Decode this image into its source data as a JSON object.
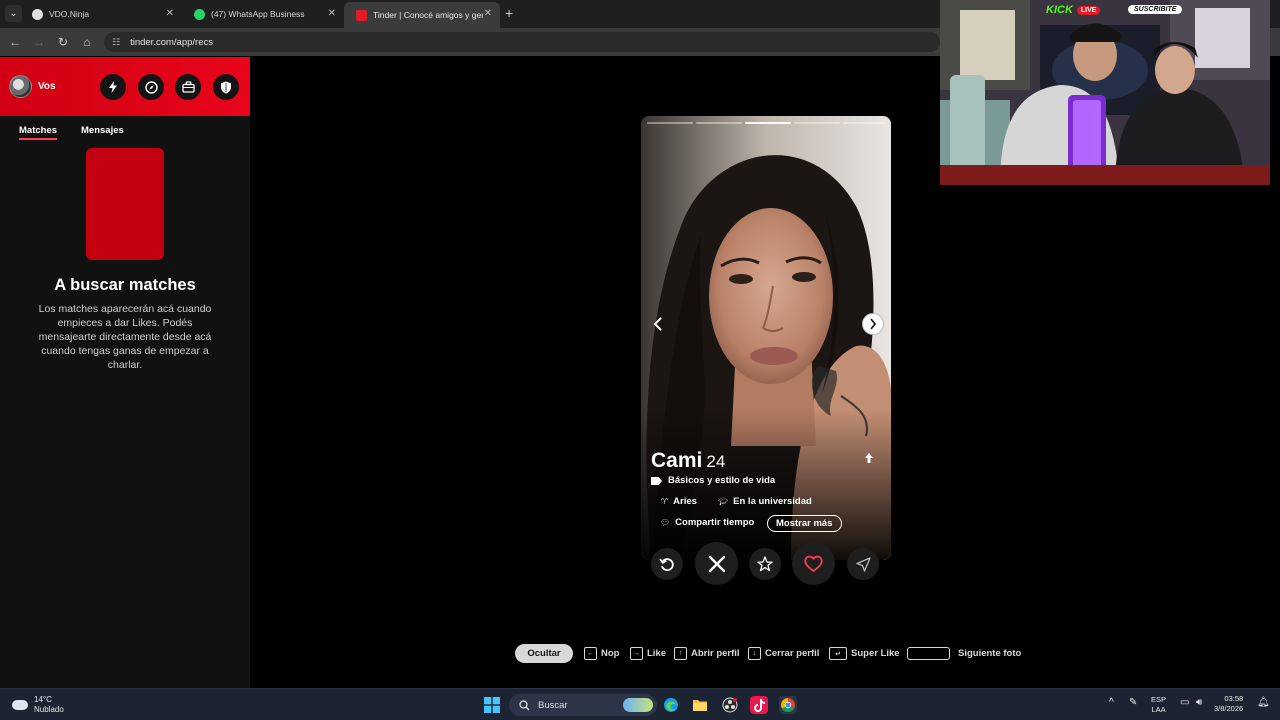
{
  "browser": {
    "tabs": [
      {
        "title": "VDO.Ninja",
        "active": false,
        "favicon_color": "#4d4d4d"
      },
      {
        "title": "(47) WhatsApp Business",
        "active": false,
        "favicon_color": "#25d366"
      },
      {
        "title": "Tinder | Conocé amigos y gente",
        "active": true,
        "favicon_color": "#fe3c55"
      }
    ],
    "new_tab_label": "+",
    "address": "tinder.com/app/recs"
  },
  "sidebar": {
    "user_name": "Vos",
    "tabs": [
      {
        "label": "Matches",
        "active": true
      },
      {
        "label": "Mensajes",
        "active": false
      }
    ],
    "empty_title": "A buscar matches",
    "empty_text": "Los matches aparecerán acá cuando empieces a dar Likes. Podés mensajearte directamente desde acá cuando tengas ganas de empezar a charlar."
  },
  "profile": {
    "name": "Cami",
    "age": "24",
    "photo_count": 5,
    "current_photo": 3,
    "tagline": "Básicos y estilo de vida",
    "chips": [
      "Aries",
      "En la universidad"
    ],
    "extra": "Compartir tiempo",
    "more_label": "Mostrar más"
  },
  "actions": [
    "rewind",
    "nope",
    "super-like",
    "like",
    "boost"
  ],
  "hints": {
    "hide_label": "Ocultar",
    "items": [
      "Nop",
      "Like",
      "Abrir perfil",
      "Cerrar perfil",
      "Super Like",
      "Siguiente foto"
    ]
  },
  "stream_overlay": {
    "platform": "KICK",
    "live": "LIVE",
    "subscribe": "SUSCRIBITE"
  },
  "taskbar": {
    "temperature": "14°C",
    "condition": "Nublado",
    "search_placeholder": "Buscar",
    "lang_top": "ESP",
    "lang_bottom": "LAA",
    "time": "03:58",
    "date": "3/8/2026"
  },
  "colors": {
    "tinder_red": "#e00514",
    "like": "#fe3c55",
    "page_bg": "#000000",
    "sidebar_bg": "#111111"
  }
}
